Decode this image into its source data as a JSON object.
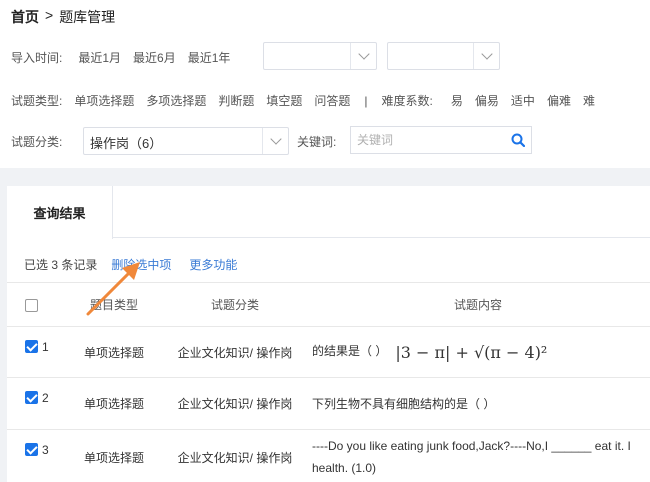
{
  "breadcrumb": {
    "home": "首页",
    "separator": ">",
    "current": "题库管理"
  },
  "filters": {
    "import_time": {
      "label": "导入时间:",
      "options": [
        "最近1月",
        "最近6月",
        "最近1年"
      ]
    },
    "question_type": {
      "label": "试题类型:",
      "options": [
        "单项选择题",
        "多项选择题",
        "判断题",
        "填空题",
        "问答题"
      ]
    },
    "divider": "|",
    "difficulty": {
      "label": "难度系数:",
      "options": [
        "易",
        "偏易",
        "适中",
        "偏难",
        "难"
      ]
    },
    "category": {
      "label": "试题分类:",
      "value": "操作岗（6）"
    },
    "keyword": {
      "label": "关键词:",
      "placeholder": "关键词"
    }
  },
  "results": {
    "tab_label": "查询结果",
    "selected_info": "已选 3 条记录",
    "delete_selected": "删除选中项",
    "more_functions": "更多功能",
    "columns": {
      "type": "题目类型",
      "category": "试题分类",
      "content": "试题内容"
    },
    "rows": [
      {
        "index": "1",
        "type": "单项选择题",
        "category": "企业文化知识/ 操作岗",
        "content": "的结果是（  ）",
        "formula": "|3 − π| + √(π − 4)²"
      },
      {
        "index": "2",
        "type": "单项选择题",
        "category": "企业文化知识/ 操作岗",
        "content": "下列生物不具有细胞结构的是（  ）"
      },
      {
        "index": "3",
        "type": "单项选择题",
        "category": "企业文化知识/ 操作岗",
        "content": "----Do you like eating junk food,Jack?----No,I ______ eat it. I",
        "content_line2": "health. (1.0)"
      }
    ]
  },
  "colors": {
    "accent": "#1a73e8",
    "link": "#3a7bd5",
    "annotation_arrow": "#f0883a"
  }
}
